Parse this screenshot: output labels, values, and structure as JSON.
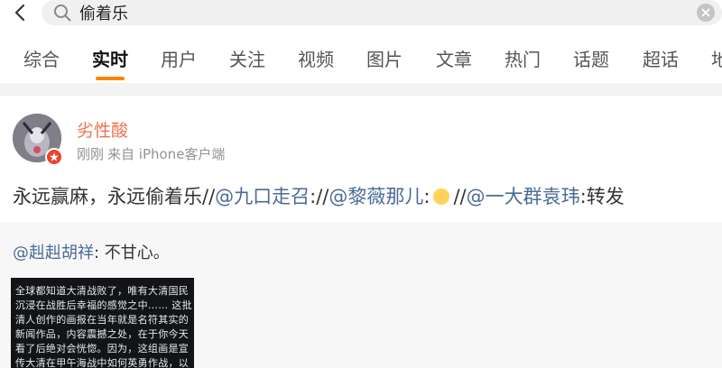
{
  "search": {
    "query": "偷着乐"
  },
  "tabs": [
    "综合",
    "实时",
    "用户",
    "关注",
    "视频",
    "图片",
    "文章",
    "热门",
    "话题",
    "超话",
    "地"
  ],
  "post": {
    "username": "劣性酸",
    "time": "刚刚",
    "source": "来自 iPhone客户端",
    "text_before": "永远赢麻，永远偷着乐//",
    "mention1": "@九口走召",
    "sep1": "://",
    "mention2": "@黎薇那儿",
    "sep2": ":",
    "sep3": "//",
    "mention3": "@一大群袁玮",
    "text_after": ":转发"
  },
  "repost": {
    "mention": "@赳赳胡祥",
    "text": ": 不甘心。",
    "image_lines": [
      "全球都知道大清战败了，唯有大清国民",
      "沉浸在战胜后幸福的感觉之中…… 这批",
      "清人创作的画报在当年就是名符其实的",
      "新闻作品，内容震撼之处，在于你今天",
      "看了后绝对会恍惚。因为，这组画是宣",
      "传大清在甲午海战中如何英勇作战，以"
    ]
  }
}
